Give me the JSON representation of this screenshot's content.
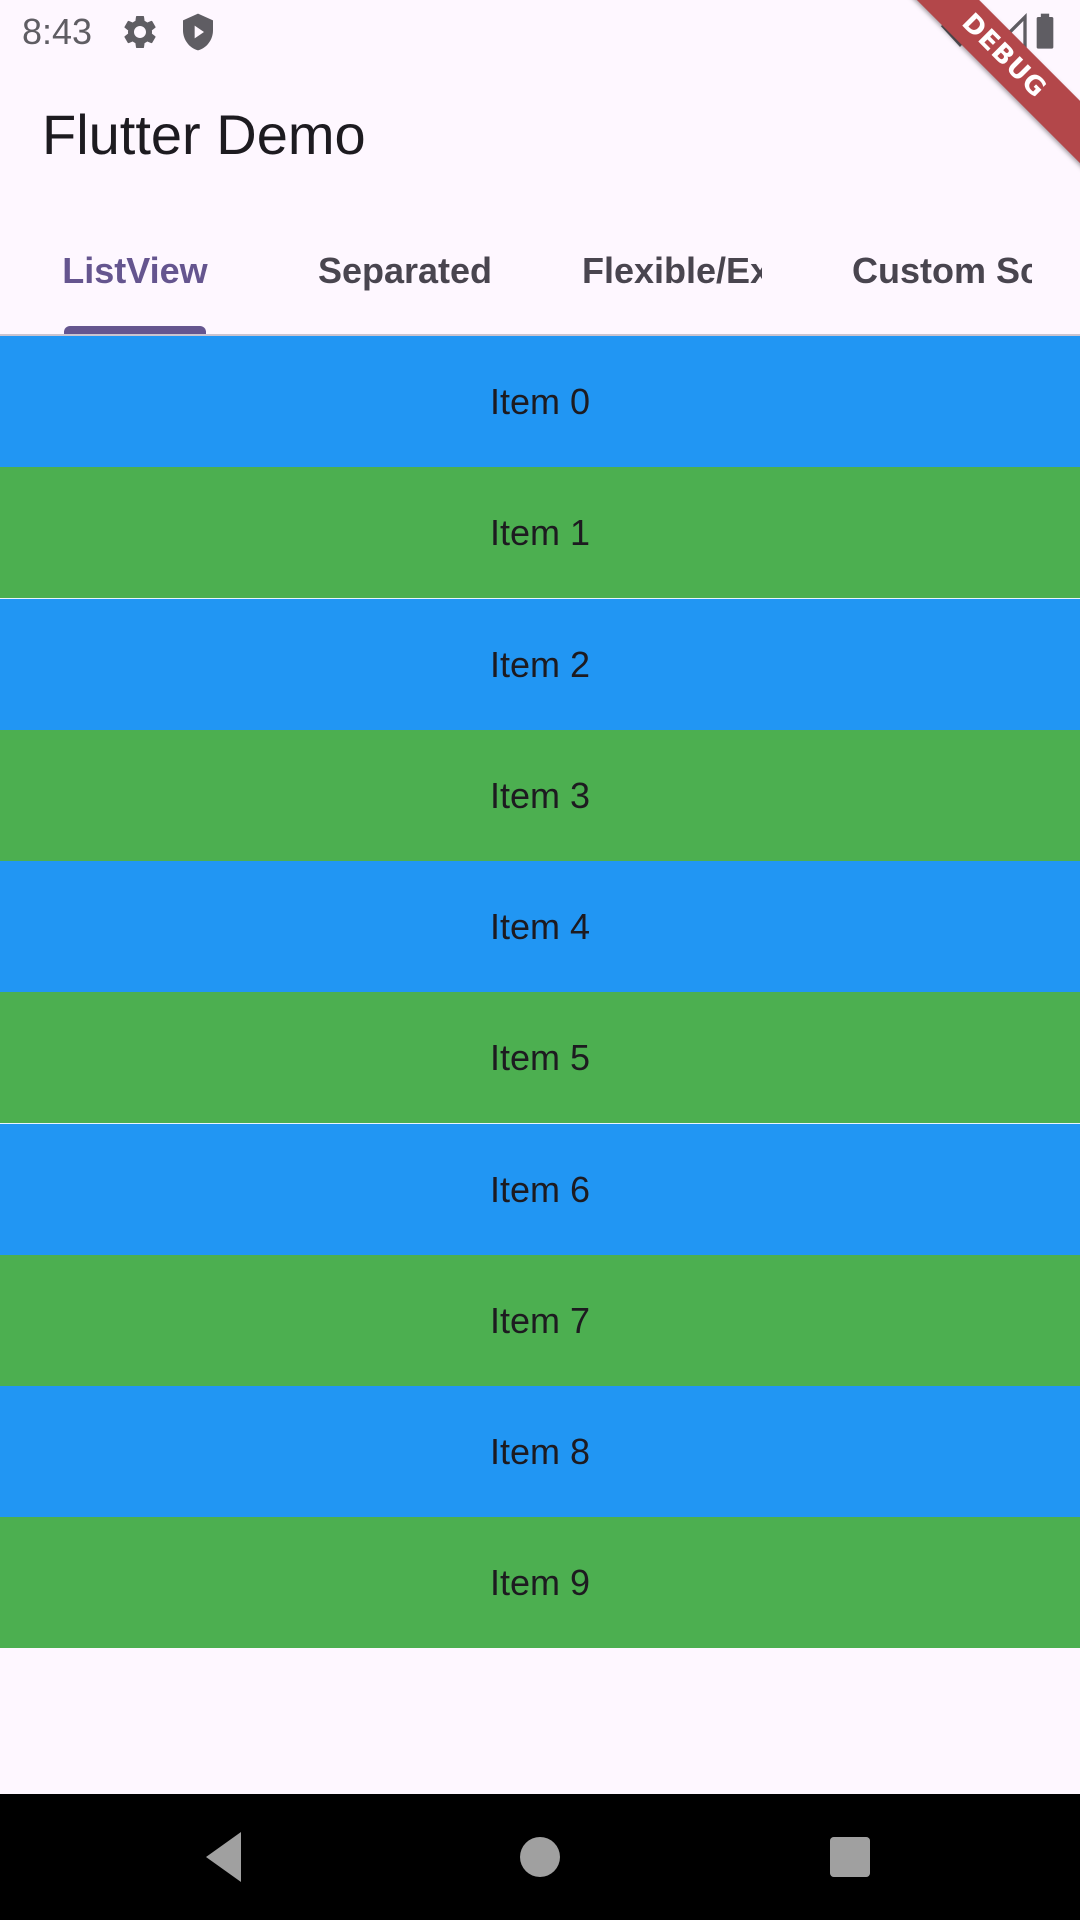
{
  "status_bar": {
    "time": "8:43",
    "icons": [
      "gear-icon",
      "shield-icon",
      "wifi-icon",
      "signal-icon",
      "battery-icon"
    ]
  },
  "debug_banner": {
    "label": "DEBUG",
    "color": "#b3474a"
  },
  "app_bar": {
    "title": "Flutter Demo"
  },
  "tabs": [
    {
      "label": "ListView",
      "selected": true
    },
    {
      "label": "Separated",
      "selected": false
    },
    {
      "label": "Flexible/Ex",
      "selected": false
    },
    {
      "label": "Custom Scr",
      "selected": false
    }
  ],
  "list": {
    "items": [
      {
        "label": "Item 0",
        "color": "blue"
      },
      {
        "label": "Item 1",
        "color": "green"
      },
      {
        "label": "Item 2",
        "color": "blue"
      },
      {
        "label": "Item 3",
        "color": "green"
      },
      {
        "label": "Item 4",
        "color": "blue"
      },
      {
        "label": "Item 5",
        "color": "green"
      },
      {
        "label": "Item 6",
        "color": "blue"
      },
      {
        "label": "Item 7",
        "color": "green"
      },
      {
        "label": "Item 8",
        "color": "blue"
      },
      {
        "label": "Item 9",
        "color": "green"
      }
    ]
  },
  "colors": {
    "background": "#fef7ff",
    "accent": "#65558f",
    "item_blue": "#2196f3",
    "item_green": "#4caf50"
  },
  "nav_bar": {
    "icons": [
      "back-icon",
      "home-icon",
      "recents-icon"
    ]
  }
}
